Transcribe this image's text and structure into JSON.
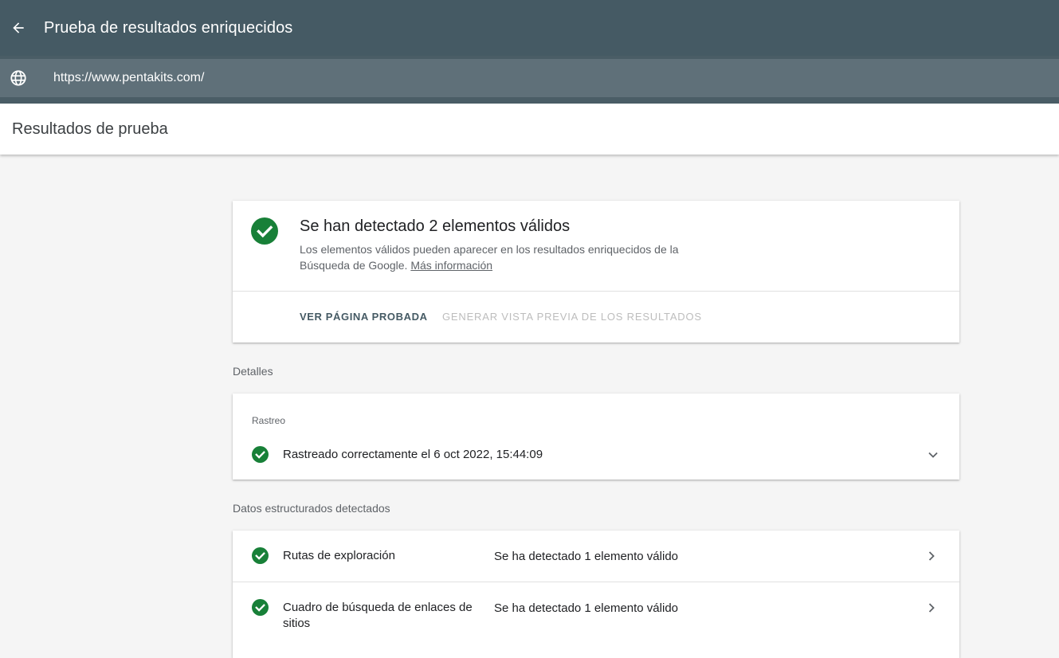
{
  "header": {
    "title": "Prueba de resultados enriquecidos",
    "back_icon": "arrow-back-icon",
    "colors": {
      "bar": "#455a64",
      "url_bar": "#5f7079"
    }
  },
  "url_bar": {
    "url": "https://www.pentakits.com/",
    "icon": "globe-icon"
  },
  "results": {
    "title": "Resultados de prueba"
  },
  "summary": {
    "title": "Se han detectado 2 elementos válidos",
    "description": "Los elementos válidos pueden aparecer en los resultados enriquecidos de la Búsqueda de Google.",
    "link": "Más información",
    "actions": {
      "view_tested": "VER PÁGINA PROBADA",
      "preview": "GENERAR VISTA PREVIA DE LOS RESULTADOS"
    },
    "status_color": "#188038"
  },
  "details": {
    "label": "Detalles",
    "crawl": {
      "label": "Rastreo",
      "status": "Rastreado correctamente el 6 oct 2022, 15:44:09"
    }
  },
  "structured_data": {
    "label": "Datos estructurados detectados",
    "items": [
      {
        "name": "Rutas de exploración",
        "status": "Se ha detectado 1 elemento válido"
      },
      {
        "name": "Cuadro de búsqueda de enlaces de sitios",
        "status": "Se ha detectado 1 elemento válido"
      }
    ]
  }
}
